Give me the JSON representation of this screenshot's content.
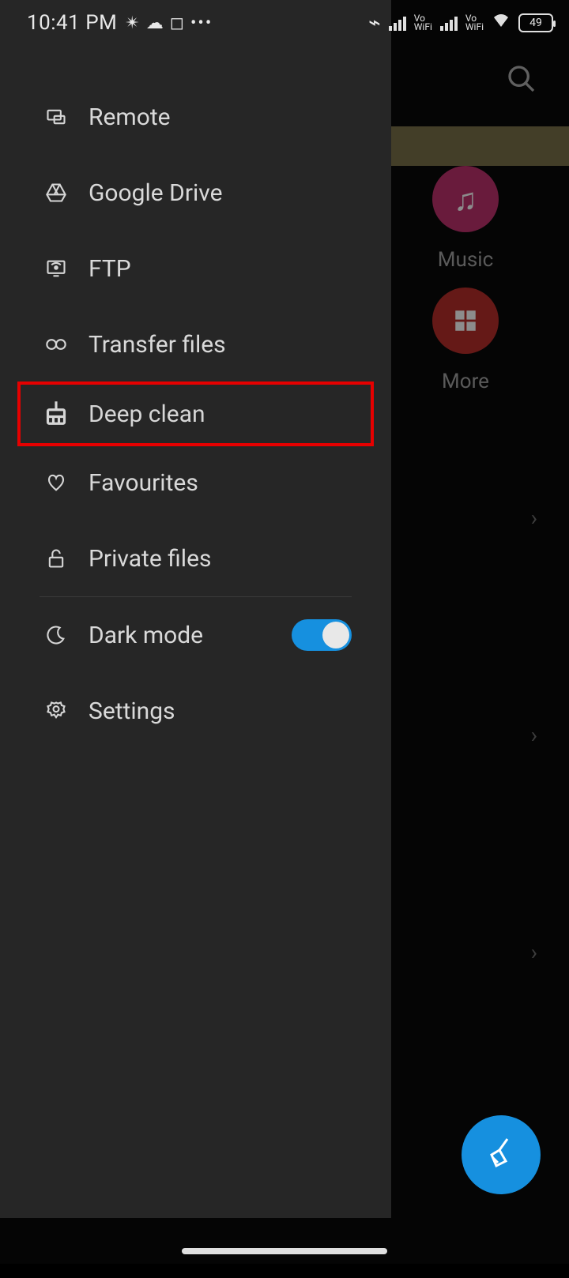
{
  "status_bar": {
    "time": "10:41 PM",
    "battery": "49"
  },
  "drawer": {
    "items": [
      {
        "label": "Remote"
      },
      {
        "label": "Google Drive"
      },
      {
        "label": "FTP"
      },
      {
        "label": "Transfer files"
      },
      {
        "label": "Deep clean"
      },
      {
        "label": "Favourites"
      },
      {
        "label": "Private files"
      },
      {
        "label": "Dark mode"
      },
      {
        "label": "Settings"
      }
    ],
    "dark_mode_on": true
  },
  "background": {
    "tiles": [
      {
        "label": "Music"
      },
      {
        "label": "More"
      }
    ]
  },
  "highlight_index": 4
}
